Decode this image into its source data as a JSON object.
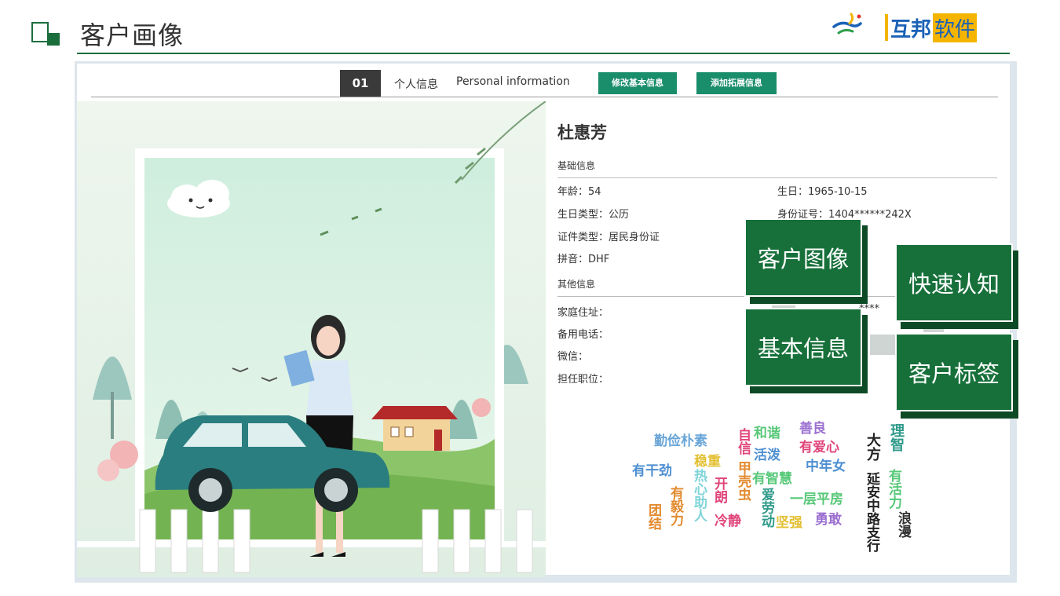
{
  "header": {
    "title": "客户画像",
    "logo_brand": "互邦",
    "logo_suffix": "软件"
  },
  "toolbar": {
    "index": "01",
    "section_cn": "个人信息",
    "section_en": "Personal information",
    "edit_button": "修改基本信息",
    "add_button": "添加拓展信息"
  },
  "profile": {
    "name": "杜惠芳",
    "basic_heading": "基础信息",
    "age": "年龄：54",
    "birthday": "生日：1965-10-15",
    "birthday_type": "生日类型：公历",
    "id_number": "身份证号：1404******242X",
    "id_type": "证件类型：居民身份证",
    "pinyin": "拼音：DHF",
    "other_heading": "其他信息",
    "home_address": "家庭住址：",
    "backup_phone": "备用电话：",
    "wechat": "微信：",
    "position": "担任职位：",
    "partial_text": "****"
  },
  "tags": [
    "勤俭朴素",
    "自信",
    "和谐",
    "善良",
    "大方",
    "理智",
    "有干劲",
    "稳重",
    "活泼",
    "有爱心",
    "中年女",
    "有活力",
    "浪漫",
    "热心助人",
    "开朗",
    "甲壳虫",
    "有智慧",
    "一层平房",
    "延安中路支行",
    "有毅力",
    "团结",
    "冷静",
    "爱劳动",
    "坚强",
    "勇敢"
  ],
  "nav_blocks": {
    "portrait": "客户图像",
    "quick": "快速认知",
    "basic": "基本信息",
    "label": "客户标签"
  },
  "colors": {
    "brand_green": "#1a6e3c",
    "button_green": "#1a8d6b",
    "block_green": "#17703a"
  }
}
